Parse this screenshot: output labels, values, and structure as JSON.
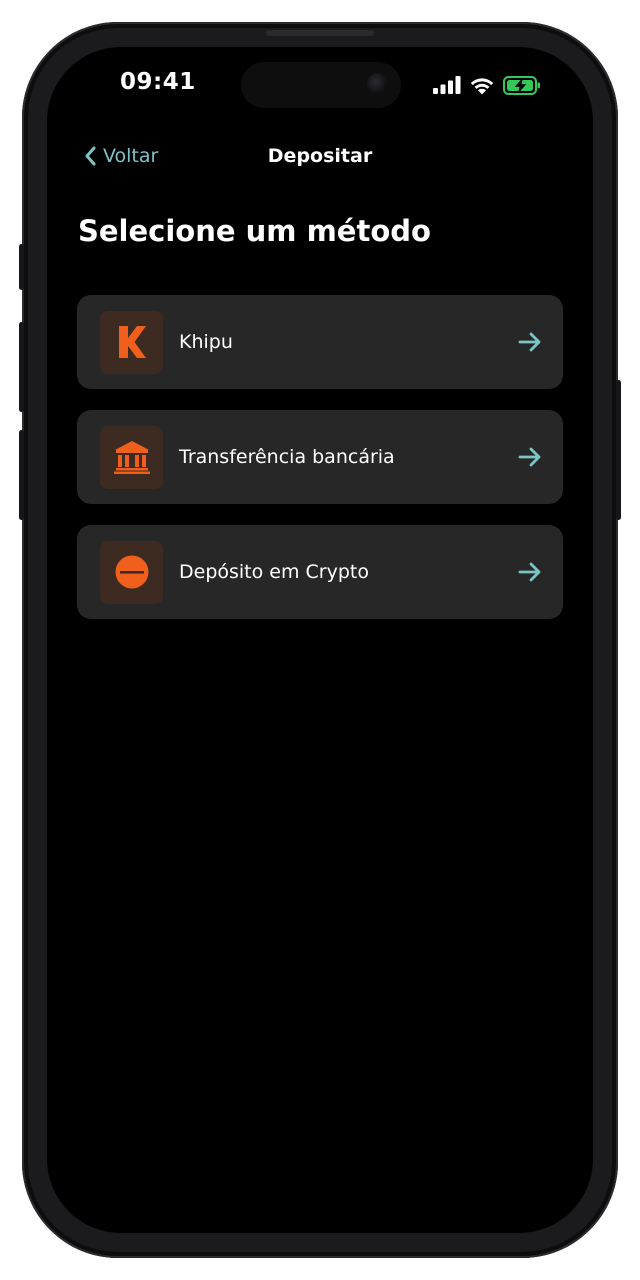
{
  "status_bar": {
    "time": "09:41"
  },
  "nav": {
    "back_label": "Voltar",
    "title": "Depositar"
  },
  "page": {
    "heading": "Selecione um método"
  },
  "methods": [
    {
      "label": "Khipu",
      "icon": "khipu-logo-icon"
    },
    {
      "label": "Transferência bancária",
      "icon": "bank-icon"
    },
    {
      "label": "Depósito em Crypto",
      "icon": "crypto-coin-icon"
    }
  ],
  "colors": {
    "accent": "#7cc4c6",
    "brand_orange": "#f0601c",
    "card_bg": "#272727",
    "icon_tile_bg": "#3d2b22",
    "battery_green": "#34c759"
  }
}
